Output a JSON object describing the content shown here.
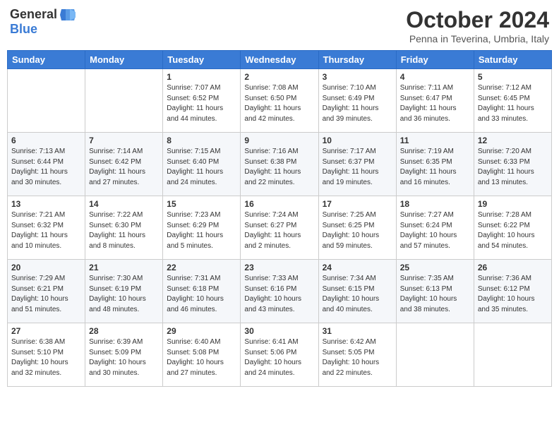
{
  "logo": {
    "general": "General",
    "blue": "Blue"
  },
  "title": {
    "month": "October 2024",
    "location": "Penna in Teverina, Umbria, Italy"
  },
  "days_of_week": [
    "Sunday",
    "Monday",
    "Tuesday",
    "Wednesday",
    "Thursday",
    "Friday",
    "Saturday"
  ],
  "weeks": [
    [
      {
        "day": "",
        "sunrise": "",
        "sunset": "",
        "daylight": ""
      },
      {
        "day": "",
        "sunrise": "",
        "sunset": "",
        "daylight": ""
      },
      {
        "day": "1",
        "sunrise": "Sunrise: 7:07 AM",
        "sunset": "Sunset: 6:52 PM",
        "daylight": "Daylight: 11 hours and 44 minutes."
      },
      {
        "day": "2",
        "sunrise": "Sunrise: 7:08 AM",
        "sunset": "Sunset: 6:50 PM",
        "daylight": "Daylight: 11 hours and 42 minutes."
      },
      {
        "day": "3",
        "sunrise": "Sunrise: 7:10 AM",
        "sunset": "Sunset: 6:49 PM",
        "daylight": "Daylight: 11 hours and 39 minutes."
      },
      {
        "day": "4",
        "sunrise": "Sunrise: 7:11 AM",
        "sunset": "Sunset: 6:47 PM",
        "daylight": "Daylight: 11 hours and 36 minutes."
      },
      {
        "day": "5",
        "sunrise": "Sunrise: 7:12 AM",
        "sunset": "Sunset: 6:45 PM",
        "daylight": "Daylight: 11 hours and 33 minutes."
      }
    ],
    [
      {
        "day": "6",
        "sunrise": "Sunrise: 7:13 AM",
        "sunset": "Sunset: 6:44 PM",
        "daylight": "Daylight: 11 hours and 30 minutes."
      },
      {
        "day": "7",
        "sunrise": "Sunrise: 7:14 AM",
        "sunset": "Sunset: 6:42 PM",
        "daylight": "Daylight: 11 hours and 27 minutes."
      },
      {
        "day": "8",
        "sunrise": "Sunrise: 7:15 AM",
        "sunset": "Sunset: 6:40 PM",
        "daylight": "Daylight: 11 hours and 24 minutes."
      },
      {
        "day": "9",
        "sunrise": "Sunrise: 7:16 AM",
        "sunset": "Sunset: 6:38 PM",
        "daylight": "Daylight: 11 hours and 22 minutes."
      },
      {
        "day": "10",
        "sunrise": "Sunrise: 7:17 AM",
        "sunset": "Sunset: 6:37 PM",
        "daylight": "Daylight: 11 hours and 19 minutes."
      },
      {
        "day": "11",
        "sunrise": "Sunrise: 7:19 AM",
        "sunset": "Sunset: 6:35 PM",
        "daylight": "Daylight: 11 hours and 16 minutes."
      },
      {
        "day": "12",
        "sunrise": "Sunrise: 7:20 AM",
        "sunset": "Sunset: 6:33 PM",
        "daylight": "Daylight: 11 hours and 13 minutes."
      }
    ],
    [
      {
        "day": "13",
        "sunrise": "Sunrise: 7:21 AM",
        "sunset": "Sunset: 6:32 PM",
        "daylight": "Daylight: 11 hours and 10 minutes."
      },
      {
        "day": "14",
        "sunrise": "Sunrise: 7:22 AM",
        "sunset": "Sunset: 6:30 PM",
        "daylight": "Daylight: 11 hours and 8 minutes."
      },
      {
        "day": "15",
        "sunrise": "Sunrise: 7:23 AM",
        "sunset": "Sunset: 6:29 PM",
        "daylight": "Daylight: 11 hours and 5 minutes."
      },
      {
        "day": "16",
        "sunrise": "Sunrise: 7:24 AM",
        "sunset": "Sunset: 6:27 PM",
        "daylight": "Daylight: 11 hours and 2 minutes."
      },
      {
        "day": "17",
        "sunrise": "Sunrise: 7:25 AM",
        "sunset": "Sunset: 6:25 PM",
        "daylight": "Daylight: 10 hours and 59 minutes."
      },
      {
        "day": "18",
        "sunrise": "Sunrise: 7:27 AM",
        "sunset": "Sunset: 6:24 PM",
        "daylight": "Daylight: 10 hours and 57 minutes."
      },
      {
        "day": "19",
        "sunrise": "Sunrise: 7:28 AM",
        "sunset": "Sunset: 6:22 PM",
        "daylight": "Daylight: 10 hours and 54 minutes."
      }
    ],
    [
      {
        "day": "20",
        "sunrise": "Sunrise: 7:29 AM",
        "sunset": "Sunset: 6:21 PM",
        "daylight": "Daylight: 10 hours and 51 minutes."
      },
      {
        "day": "21",
        "sunrise": "Sunrise: 7:30 AM",
        "sunset": "Sunset: 6:19 PM",
        "daylight": "Daylight: 10 hours and 48 minutes."
      },
      {
        "day": "22",
        "sunrise": "Sunrise: 7:31 AM",
        "sunset": "Sunset: 6:18 PM",
        "daylight": "Daylight: 10 hours and 46 minutes."
      },
      {
        "day": "23",
        "sunrise": "Sunrise: 7:33 AM",
        "sunset": "Sunset: 6:16 PM",
        "daylight": "Daylight: 10 hours and 43 minutes."
      },
      {
        "day": "24",
        "sunrise": "Sunrise: 7:34 AM",
        "sunset": "Sunset: 6:15 PM",
        "daylight": "Daylight: 10 hours and 40 minutes."
      },
      {
        "day": "25",
        "sunrise": "Sunrise: 7:35 AM",
        "sunset": "Sunset: 6:13 PM",
        "daylight": "Daylight: 10 hours and 38 minutes."
      },
      {
        "day": "26",
        "sunrise": "Sunrise: 7:36 AM",
        "sunset": "Sunset: 6:12 PM",
        "daylight": "Daylight: 10 hours and 35 minutes."
      }
    ],
    [
      {
        "day": "27",
        "sunrise": "Sunrise: 6:38 AM",
        "sunset": "Sunset: 5:10 PM",
        "daylight": "Daylight: 10 hours and 32 minutes."
      },
      {
        "day": "28",
        "sunrise": "Sunrise: 6:39 AM",
        "sunset": "Sunset: 5:09 PM",
        "daylight": "Daylight: 10 hours and 30 minutes."
      },
      {
        "day": "29",
        "sunrise": "Sunrise: 6:40 AM",
        "sunset": "Sunset: 5:08 PM",
        "daylight": "Daylight: 10 hours and 27 minutes."
      },
      {
        "day": "30",
        "sunrise": "Sunrise: 6:41 AM",
        "sunset": "Sunset: 5:06 PM",
        "daylight": "Daylight: 10 hours and 24 minutes."
      },
      {
        "day": "31",
        "sunrise": "Sunrise: 6:42 AM",
        "sunset": "Sunset: 5:05 PM",
        "daylight": "Daylight: 10 hours and 22 minutes."
      },
      {
        "day": "",
        "sunrise": "",
        "sunset": "",
        "daylight": ""
      },
      {
        "day": "",
        "sunrise": "",
        "sunset": "",
        "daylight": ""
      }
    ]
  ]
}
